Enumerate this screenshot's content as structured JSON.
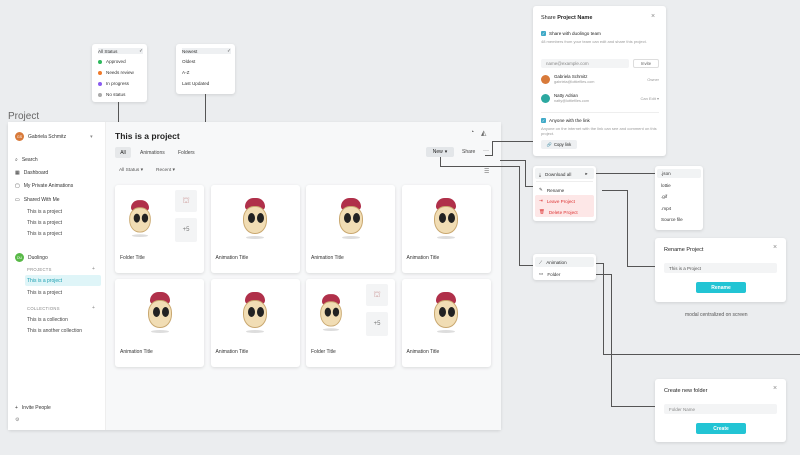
{
  "page_label": "Project",
  "status_dropdown": {
    "items": [
      {
        "label": "All Status",
        "dot": "",
        "checked": true
      },
      {
        "label": "Approved",
        "dot": "#2db85c"
      },
      {
        "label": "Needs review",
        "dot": "#f07a2a"
      },
      {
        "label": "In progress",
        "dot": "#8a5cf0"
      },
      {
        "label": "No status",
        "dot": "#aaaaaa"
      }
    ]
  },
  "sort_dropdown": {
    "items": [
      {
        "label": "Newest",
        "checked": true
      },
      {
        "label": "Oldest"
      },
      {
        "label": "A-Z"
      },
      {
        "label": "Last Updated"
      }
    ]
  },
  "sidebar": {
    "user": {
      "initials": "GS",
      "name": "Gabriela Schmitz"
    },
    "search": "Search",
    "dashboard": "Dashboard",
    "private": "My Private Animations",
    "shared": "Shared With Me",
    "shared_items": [
      "This is a project",
      "This is a project",
      "This is a project"
    ],
    "team": {
      "initials": "DU",
      "name": "Duolingo"
    },
    "projects_head": "PROJECTS",
    "projects": [
      "This is a project",
      "This is a project"
    ],
    "collections_head": "COLLECTIONS",
    "collections": [
      "This is a collection",
      "This is another collection"
    ],
    "invite": "Invite People"
  },
  "main": {
    "title": "This is a project",
    "tabs": [
      "All",
      "Animations",
      "Folders"
    ],
    "filter_status": "All Status",
    "filter_sort": "Recent",
    "new_btn": "New",
    "share_btn": "Share",
    "more": "···",
    "tiles": [
      {
        "title": "Folder Title",
        "folder": true,
        "more": "+5"
      },
      {
        "title": "Animation Title"
      },
      {
        "title": "Animation Title"
      },
      {
        "title": "Animation Title"
      },
      {
        "title": "Animation Title"
      },
      {
        "title": "Animation Title"
      },
      {
        "title": "Folder Title",
        "folder": true,
        "more": "+5"
      },
      {
        "title": "Animation Title"
      }
    ]
  },
  "share_panel": {
    "title_prefix": "Share",
    "title_name": "Project Name",
    "share_team": "Share with duolingo team",
    "share_team_desc": "48 members from your team can edit and share this project.",
    "email_placeholder": "name@example.com",
    "invite_btn": "Invite",
    "members": [
      {
        "name": "Gabriela Schmitz",
        "email": "gabriela@lottiefiles.com",
        "role": "Owner",
        "color": "#d87a3a"
      },
      {
        "name": "Natty Adrian",
        "email": "natty@lottiefiles.com",
        "role": "Can Edit ▾",
        "color": "#2ca8a0"
      }
    ],
    "anyone_link": "Anyone with the link",
    "anyone_desc": "Anyone on the internet with the link can see and comment on this project.",
    "copy_link": "Copy link"
  },
  "more_menu": {
    "download": "Download all",
    "rename": "Rename",
    "leave": "Leave Project",
    "delete": "Delete Project"
  },
  "format_menu": {
    "items": [
      ".json",
      "lottie",
      ".gif",
      ".mp4",
      "Source file"
    ]
  },
  "new_menu": {
    "items": [
      "Animation",
      "Folder"
    ]
  },
  "rename_modal": {
    "title": "Rename Project",
    "value": "This is a Project",
    "button": "Rename"
  },
  "caption": "modal centralized on screen",
  "folder_modal": {
    "title": "Create new folder",
    "placeholder": "Folder Name",
    "button": "Create"
  }
}
